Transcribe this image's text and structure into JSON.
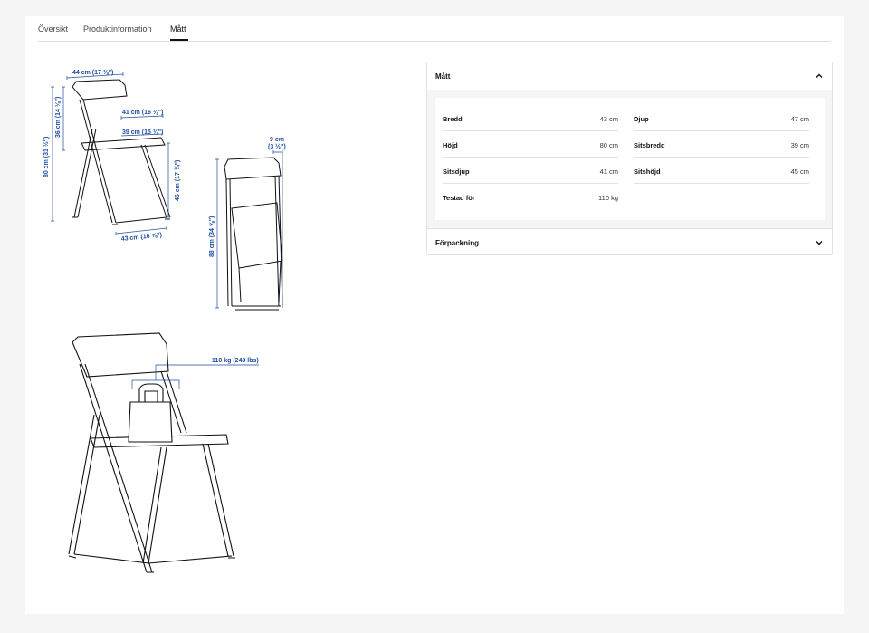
{
  "tabs": [
    {
      "label": "Översikt",
      "active": false
    },
    {
      "label": "Produktinformation",
      "active": false
    },
    {
      "label": "Mått",
      "active": true
    }
  ],
  "drawing": {
    "dims": {
      "width_top": "44 cm (17 ⅜\")",
      "height_back": "36 cm (14 ⅛\")",
      "height_total": "80 cm (31 ½\")",
      "seat_depth": "41 cm (16 ⅛\")",
      "seat_width": "39 cm (15 ⅜\")",
      "seat_height": "45 cm (17 ¾\")",
      "width_base": "43 cm (16 ⅞\")",
      "folded_depth_1": "9 cm",
      "folded_depth_2": "(3 ½\")",
      "folded_height": "88 cm (34 ⅝\")",
      "load": "110 kg (243 lbs)"
    }
  },
  "measurements": {
    "title": "Mått",
    "rows": [
      {
        "label": "Bredd",
        "value": "43 cm"
      },
      {
        "label": "Djup",
        "value": "47 cm"
      },
      {
        "label": "Höjd",
        "value": "80 cm"
      },
      {
        "label": "Sitsbredd",
        "value": "39 cm"
      },
      {
        "label": "Sitsdjup",
        "value": "41 cm"
      },
      {
        "label": "Sitshöjd",
        "value": "45 cm"
      },
      {
        "label": "Testad för",
        "value": "110 kg"
      }
    ]
  },
  "packaging": {
    "title": "Förpackning"
  },
  "colors": {
    "dimension_blue": "#1f4fa0",
    "line": "#111111",
    "background": "#f5f5f5"
  }
}
